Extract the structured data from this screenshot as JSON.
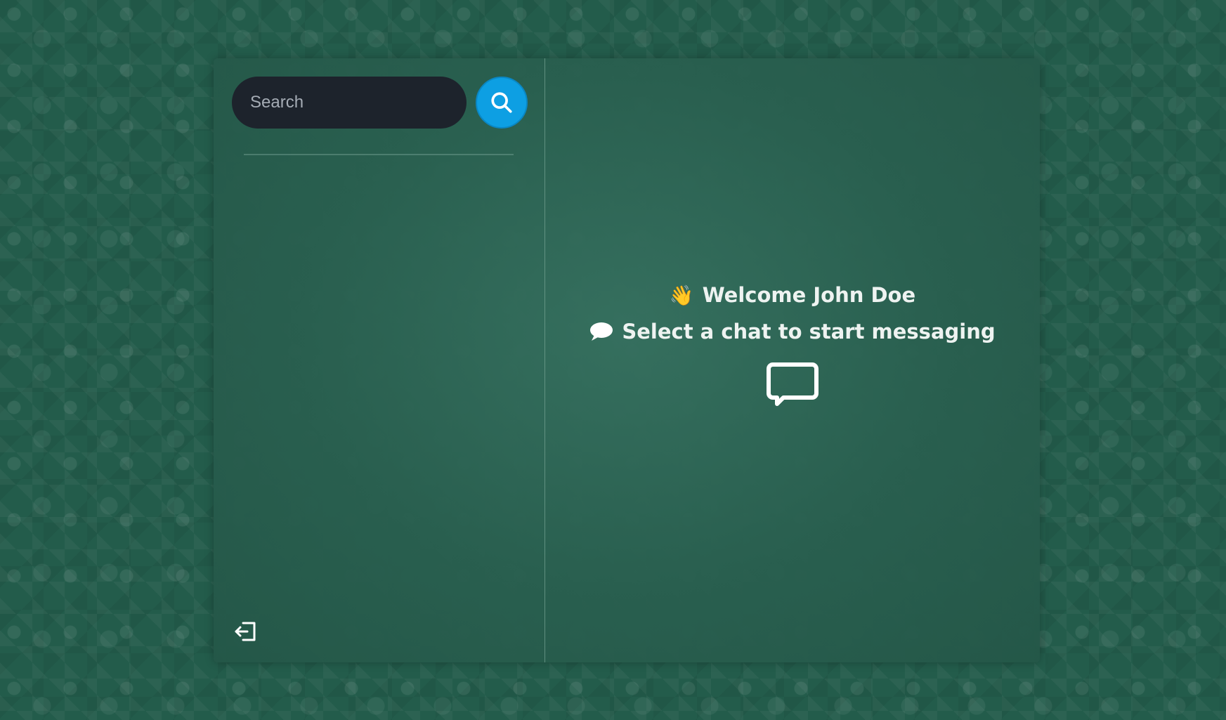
{
  "sidebar": {
    "search": {
      "placeholder": "Search",
      "value": ""
    },
    "search_button_icon": "search-icon",
    "logout_icon": "logout-icon"
  },
  "main": {
    "welcome_emoji": "👋",
    "welcome_text": "Welcome John Doe",
    "hint_icon": "speech-bubble-icon",
    "hint_text": "Select a chat to start messaging",
    "center_icon": "message-square-icon"
  },
  "colors": {
    "background": "#235c4b",
    "panel": "#2f6a59",
    "search_bg": "#1d232c",
    "accent": "#0d9fe3",
    "text": "#eef3f1"
  }
}
